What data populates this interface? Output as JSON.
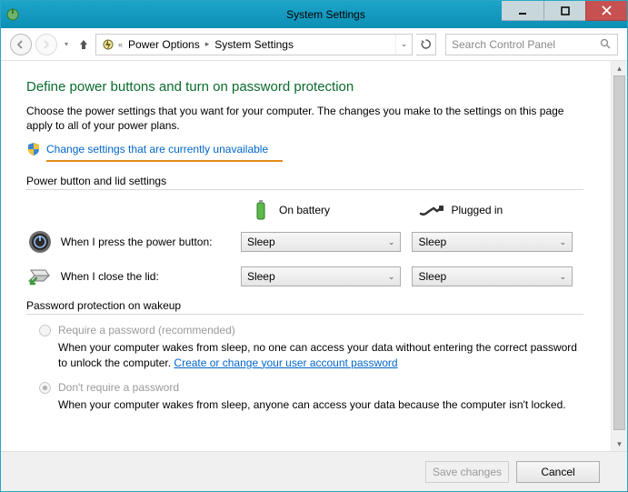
{
  "window": {
    "title": "System Settings"
  },
  "breadcrumb": {
    "seg1": "Power Options",
    "seg2": "System Settings"
  },
  "search": {
    "placeholder": "Search Control Panel"
  },
  "heading": "Define power buttons and turn on password protection",
  "subtext": "Choose the power settings that you want for your computer. The changes you make to the settings on this page apply to all of your power plans.",
  "change_link": "Change settings that are currently unavailable",
  "section_power": "Power button and lid settings",
  "col_battery": "On battery",
  "col_plugged": "Plugged in",
  "row_power_button": "When I press the power button:",
  "row_close_lid": "When I close the lid:",
  "select_value": "Sleep",
  "section_password": "Password protection on wakeup",
  "radio_require": {
    "label": "Require a password (recommended)",
    "desc_a": "When your computer wakes from sleep, no one can access your data without entering the correct password to unlock the computer. ",
    "link": "Create or change your user account password"
  },
  "radio_dont": {
    "label": "Don't require a password",
    "desc": "When your computer wakes from sleep, anyone can access your data because the computer isn't locked."
  },
  "footer": {
    "save": "Save changes",
    "cancel": "Cancel"
  }
}
